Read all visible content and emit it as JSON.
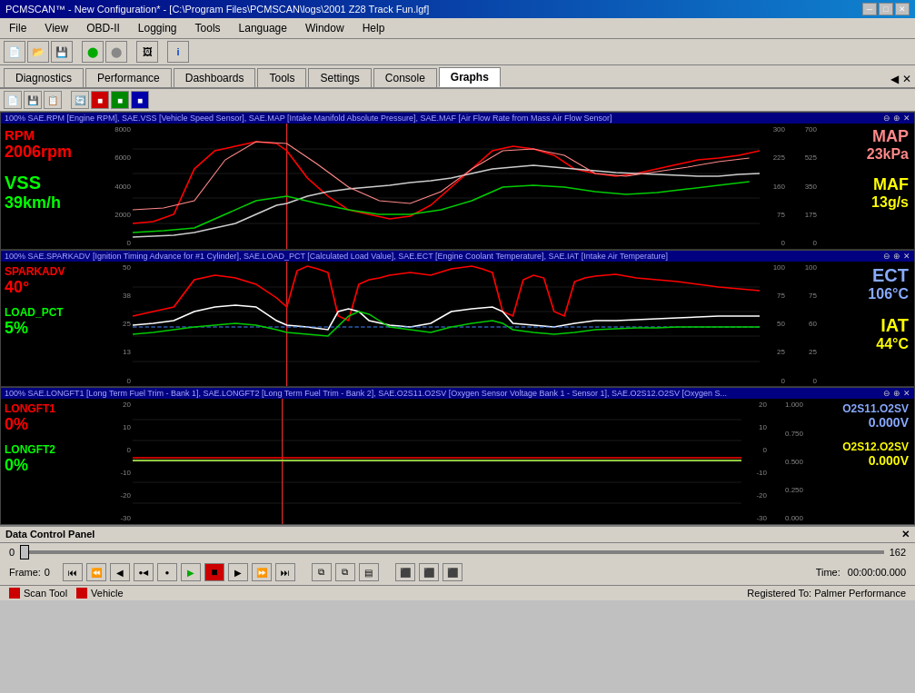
{
  "window": {
    "title": "PCMSCAN™ - New Configuration* - [C:\\Program Files\\PCMSCAN\\logs\\2001 Z28 Track Fun.lgf]",
    "min_label": "─",
    "max_label": "□",
    "close_label": "✕"
  },
  "menu": {
    "items": [
      "File",
      "View",
      "OBD-II",
      "Logging",
      "Tools",
      "Language",
      "Window",
      "Help"
    ]
  },
  "tabs": {
    "items": [
      "Diagnostics",
      "Performance",
      "Dashboards",
      "Tools",
      "Settings",
      "Console",
      "Graphs"
    ],
    "active": "Graphs"
  },
  "graphs": {
    "panel1": {
      "header": "100% SAE.RPM [Engine RPM], SAE.VSS [Vehicle Speed Sensor], SAE.MAP [Intake Manifold Absolute Pressure], SAE.MAF [Air Flow Rate from Mass Air Flow Sensor]",
      "left_labels": [
        {
          "name": "RPM",
          "value": "2006rpm",
          "color": "#ff0000"
        },
        {
          "name": "VSS",
          "value": "39km/h",
          "color": "#00ff00"
        }
      ],
      "right_labels": [
        {
          "name": "MAP",
          "value": "23kPa",
          "name_color": "#ff8888",
          "value_color": "#ff8888"
        },
        {
          "name": "MAF",
          "value": "13g/s",
          "name_color": "#ffff00",
          "value_color": "#ffff00"
        }
      ],
      "yscale_left": [
        "8000",
        "6000",
        "4000",
        "2000",
        "0"
      ],
      "yscale_mid": [
        "300",
        "225",
        "160",
        "75",
        "0"
      ],
      "yscale_right": [
        "700",
        "525",
        "350",
        "175",
        "0"
      ]
    },
    "panel2": {
      "header": "100% SAE.SPARKADV [Ignition Timing Advance for #1 Cylinder], SAE.LOAD_PCT [Calculated Load Value], SAE.ECT [Engine Coolant Temperature], SAE.IAT [Intake Air Temperature]",
      "left_labels": [
        {
          "name": "SPARKADV",
          "value": "40°",
          "color": "#ff0000"
        },
        {
          "name": "LOAD_PCT",
          "value": "5%",
          "color": "#00ff00"
        }
      ],
      "right_labels": [
        {
          "name": "ECT",
          "value": "106°C",
          "name_color": "#88aaff",
          "value_color": "#88aaff"
        },
        {
          "name": "IAT",
          "value": "44°C",
          "name_color": "#ffff00",
          "value_color": "#ffff00"
        }
      ],
      "yscale_left": [
        "50",
        "38",
        "25",
        "13",
        "0"
      ],
      "yscale_mid": [
        "100",
        "75",
        "50",
        "25",
        "0"
      ],
      "yscale_right": [
        "100",
        "75",
        "60",
        "25",
        "0"
      ]
    },
    "panel3": {
      "header": "100% SAE.LONGFT1 [Long Term Fuel Trim - Bank 1], SAE.LONGFT2 [Long Term Fuel Trim - Bank 2], SAE.O2S11.O2SV [Oxygen Sensor Voltage Bank 1 - Sensor 1], SAE.O2S12.O2SV [Oxygen S...",
      "left_labels": [
        {
          "name": "LONGFT1",
          "value": "0%",
          "color": "#ff0000"
        },
        {
          "name": "LONGFT2",
          "value": "0%",
          "color": "#00ff00"
        }
      ],
      "right_labels": [
        {
          "name": "O2S11.O2SV",
          "value": "0.000V",
          "name_color": "#88aaff",
          "value_color": "#88aaff"
        },
        {
          "name": "O2S12.O2SV",
          "value": "0.000V",
          "name_color": "#ffff00",
          "value_color": "#ffff00"
        }
      ],
      "yscale_left": [
        "20",
        "10",
        "0",
        "-10",
        "-20",
        "-30"
      ],
      "yscale_mid": [
        "20",
        "10",
        "0",
        "-10",
        "-20",
        "-30"
      ],
      "yscale_right": [
        "1.000",
        "0.750",
        "0.500",
        "0.250",
        "0.000"
      ]
    }
  },
  "data_control": {
    "title": "Data Control Panel",
    "close_label": "✕",
    "slider_min": "0",
    "slider_max": "162",
    "slider_value": 0,
    "frame_label": "Frame:",
    "frame_value": "0",
    "time_label": "Time:",
    "time_value": "00:00:00.000",
    "buttons": {
      "first": "⏮",
      "prev_fast": "⏪",
      "prev": "◀",
      "rec_prev": "●◀",
      "rec": "●",
      "play": "▶",
      "stop": "■",
      "next": "▶",
      "next_fast": "⏩",
      "last": "⏭",
      "copy": "⧉",
      "paste": "⧉",
      "export1": "⬛",
      "export2": "⬛",
      "export3": "⬛"
    }
  },
  "status_bar": {
    "scan_tool_label": "Scan Tool",
    "vehicle_label": "Vehicle",
    "registered_to": "Registered To: Palmer Performance"
  },
  "colors": {
    "accent_blue": "#000080",
    "text_red": "#ff0000",
    "text_green": "#00ff00",
    "text_yellow": "#ffff00",
    "text_cyan": "#00ffff",
    "bg_dark": "#000000",
    "bg_light": "#d4d0c8"
  }
}
